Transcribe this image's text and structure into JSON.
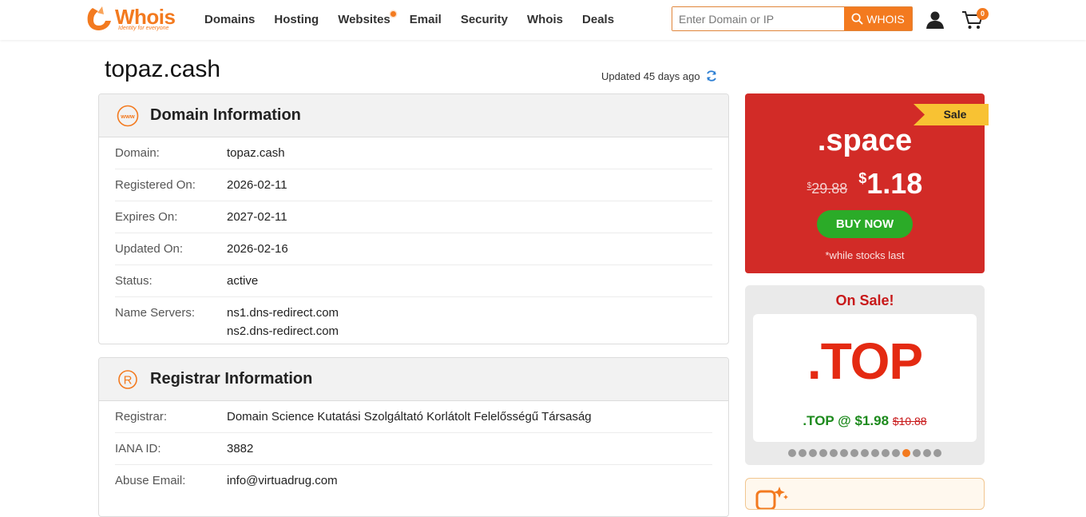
{
  "header": {
    "logo_text": "Whois",
    "logo_tagline": "Identity for everyone",
    "nav": [
      "Domains",
      "Hosting",
      "Websites",
      "Email",
      "Security",
      "Whois",
      "Deals"
    ],
    "search_placeholder": "Enter Domain or IP",
    "search_button": "WHOIS",
    "cart_count": "0",
    "accent": "#f37a1f"
  },
  "page": {
    "title": "topaz.cash",
    "updated": "Updated 45 days ago"
  },
  "domain_info": {
    "title": "Domain Information",
    "rows": [
      {
        "label": "Domain:",
        "value": "topaz.cash"
      },
      {
        "label": "Registered On:",
        "value": "2026-02-11"
      },
      {
        "label": "Expires On:",
        "value": "2027-02-11"
      },
      {
        "label": "Updated On:",
        "value": "2026-02-16"
      },
      {
        "label": "Status:",
        "value": "active"
      },
      {
        "label": "Name Servers:",
        "value": "ns1.dns-redirect.com",
        "value2": "ns2.dns-redirect.com"
      }
    ]
  },
  "registrar_info": {
    "title": "Registrar Information",
    "rows": [
      {
        "label": "Registrar:",
        "value": "Domain Science Kutatási Szolgáltató Korlátolt Felelősségű Társaság"
      },
      {
        "label": "IANA ID:",
        "value": "3882"
      },
      {
        "label": "Abuse Email:",
        "value": "info@virtuadrug.com"
      }
    ]
  },
  "promo_space": {
    "ribbon": "Sale",
    "tld": ".space",
    "old_currency": "$",
    "old_price": "29.88",
    "new_currency": "$",
    "new_price": "1.18",
    "button": "BUY NOW",
    "note": "*while stocks last",
    "bg_color": "#d22b27"
  },
  "promo_top": {
    "title": "On Sale!",
    "tld": ".TOP",
    "price_text": ".TOP @ $1.98",
    "old_price": "$10.88",
    "dot_count": 15,
    "active_dot": 11
  }
}
